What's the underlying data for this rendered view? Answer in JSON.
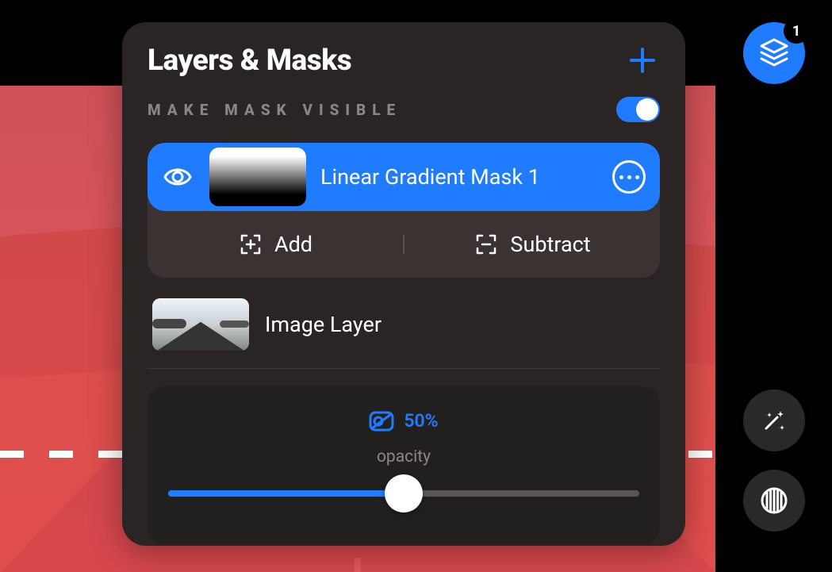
{
  "panel": {
    "title": "Layers & Masks",
    "visibility": {
      "label": "MAKE MASK VISIBLE",
      "on": true
    },
    "mask": {
      "name": "Linear Gradient Mask 1"
    },
    "mask_actions": {
      "add": "Add",
      "subtract": "Subtract"
    },
    "image_layer": {
      "name": "Image Layer"
    },
    "opacity": {
      "value_label": "50%",
      "label": "opacity",
      "value_pct": 50
    }
  },
  "fab": {
    "layers_badge": "1"
  },
  "colors": {
    "accent": "#1f7bff",
    "panel_bg": "#2b2424"
  }
}
